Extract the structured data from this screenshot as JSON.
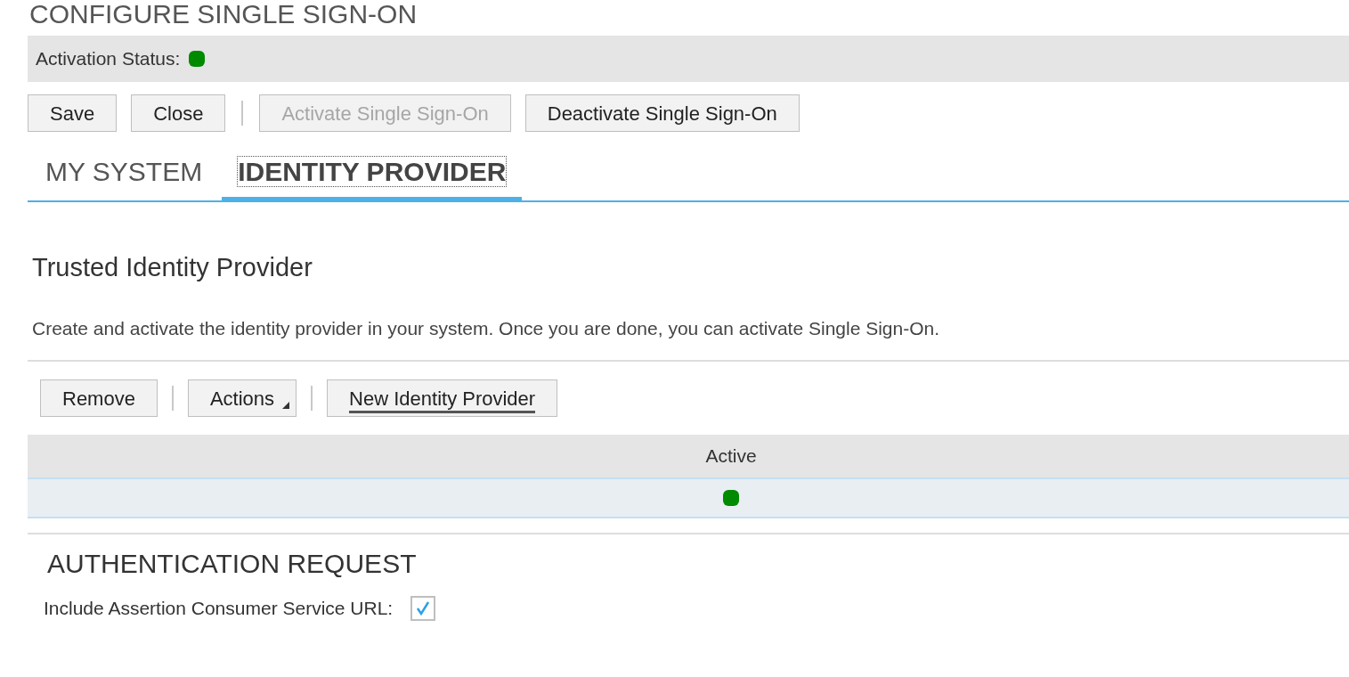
{
  "title": "CONFIGURE SINGLE SIGN-ON",
  "activation_status": {
    "label": "Activation Status:",
    "active": true
  },
  "toolbar": [
    {
      "kind": "button",
      "label": "Save",
      "disabled": false
    },
    {
      "kind": "button",
      "label": "Close",
      "disabled": false
    },
    {
      "kind": "separator"
    },
    {
      "kind": "button",
      "label": "Activate Single Sign-On",
      "disabled": true
    },
    {
      "kind": "button",
      "label": "Deactivate Single Sign-On",
      "disabled": false
    }
  ],
  "tabs": [
    {
      "label": "MY SYSTEM",
      "selected": false
    },
    {
      "label": "IDENTITY PROVIDER",
      "selected": true
    }
  ],
  "section": {
    "title": "Trusted Identity Provider",
    "description": "Create and activate the identity provider in your system. Once you are done, you can activate Single Sign-On."
  },
  "table_toolbar": [
    {
      "kind": "button",
      "label": "Remove",
      "emphasized": false
    },
    {
      "kind": "separator"
    },
    {
      "kind": "menu",
      "label": "Actions",
      "emphasized": false
    },
    {
      "kind": "separator"
    },
    {
      "kind": "button",
      "label": "New Identity Provider",
      "emphasized": true
    }
  ],
  "table": {
    "columns": [
      "Active"
    ],
    "rows": [
      {
        "active": true,
        "selected": true
      }
    ]
  },
  "authentication_request": {
    "title": "AUTHENTICATION REQUEST",
    "label": "Include Assertion Consumer Service URL:",
    "checked": true
  }
}
